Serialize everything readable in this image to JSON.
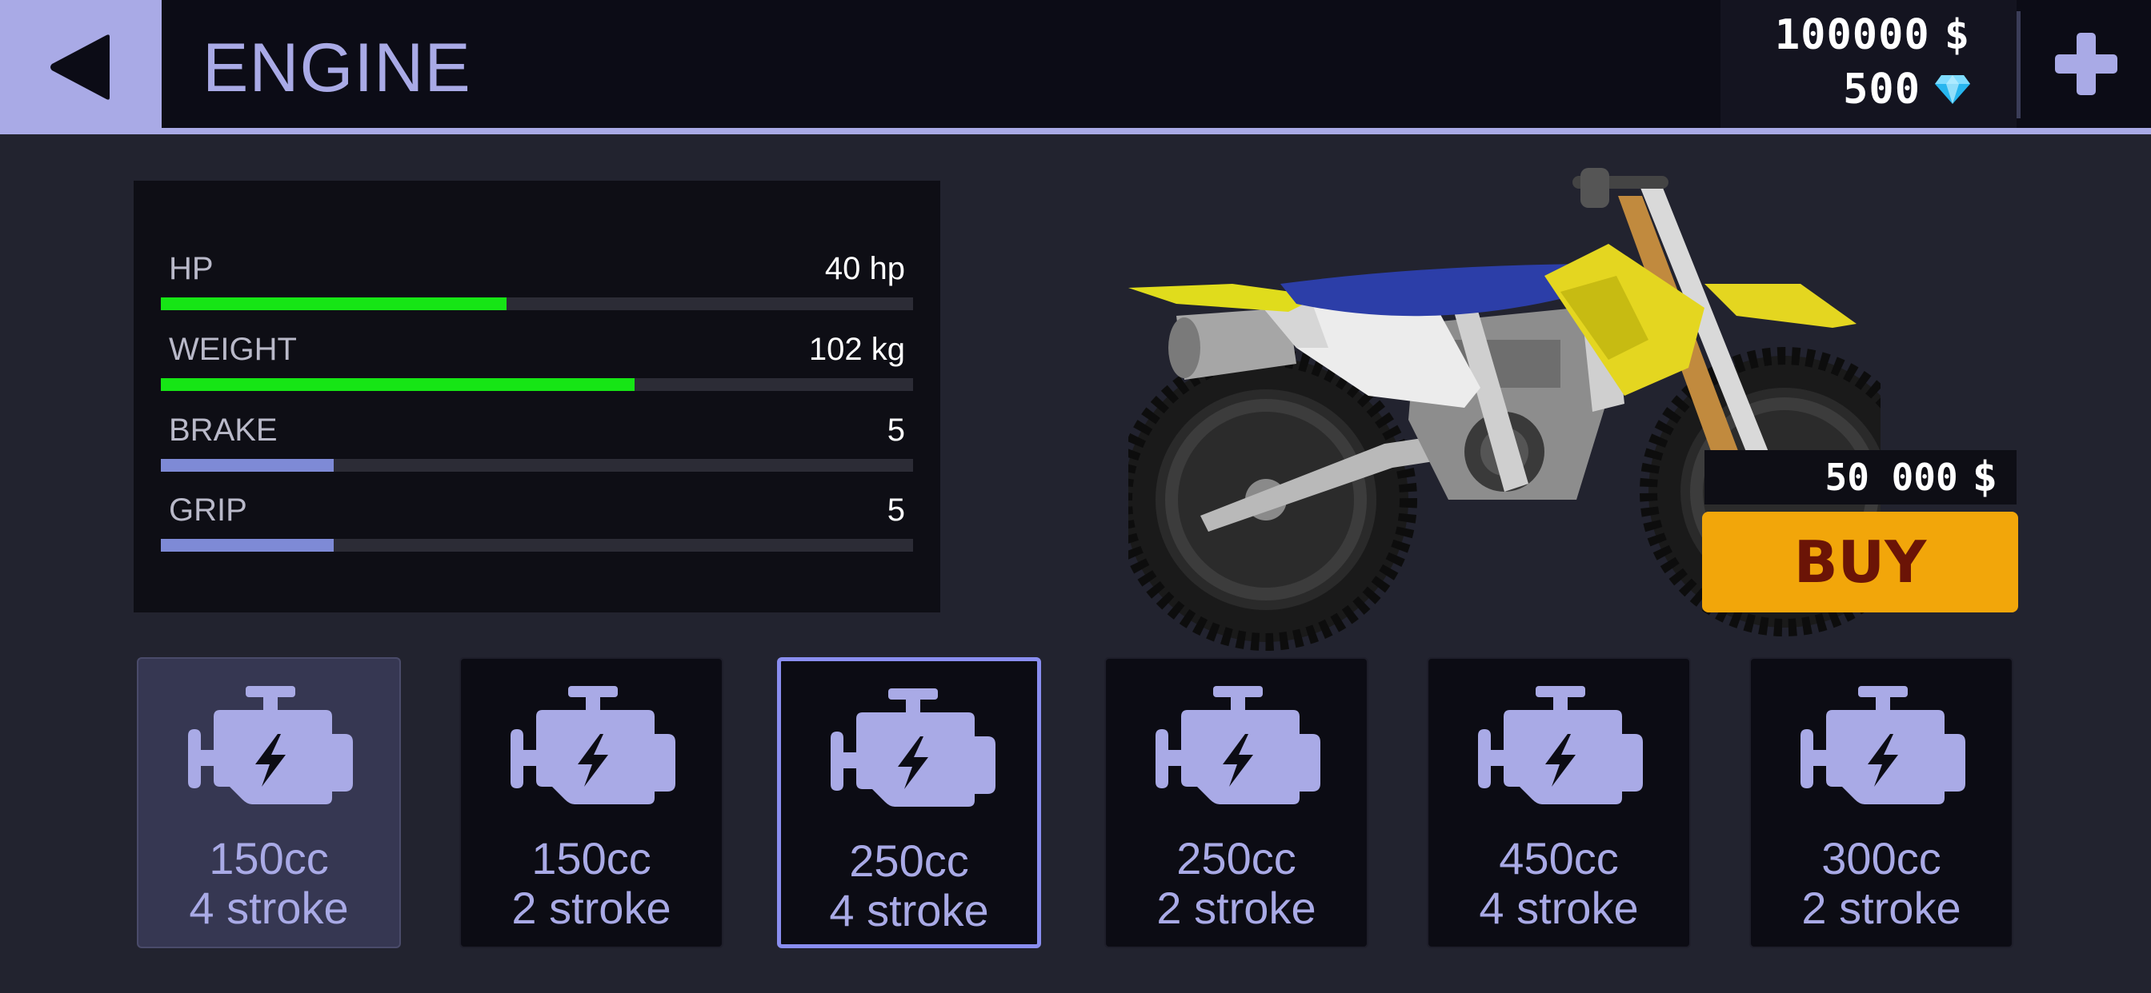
{
  "header": {
    "title": "ENGINE",
    "cash": "100000",
    "cash_symbol": "$",
    "gems": "500"
  },
  "stats": [
    {
      "label": "HP",
      "value": "40 hp",
      "fill": 0.46,
      "color": "#16e515"
    },
    {
      "label": "WEIGHT",
      "value": "102 kg",
      "fill": 0.63,
      "color": "#16e515"
    },
    {
      "label": "BRAKE",
      "value": "5",
      "fill": 0.23,
      "color": "#7e8ad6"
    },
    {
      "label": "GRIP",
      "value": "5",
      "fill": 0.23,
      "color": "#7e8ad6"
    }
  ],
  "purchase": {
    "price": "50 000",
    "price_symbol": "$",
    "buy_label": "BUY"
  },
  "engines": [
    {
      "size": "150cc",
      "type": "4 stroke",
      "state": "owned"
    },
    {
      "size": "150cc",
      "type": "2 stroke",
      "state": "normal"
    },
    {
      "size": "250cc",
      "type": "4 stroke",
      "state": "selected"
    },
    {
      "size": "250cc",
      "type": "2 stroke",
      "state": "normal"
    },
    {
      "size": "450cc",
      "type": "4 stroke",
      "state": "normal"
    },
    {
      "size": "300cc",
      "type": "2 stroke",
      "state": "normal"
    }
  ],
  "icons": {
    "back": "back-arrow-icon",
    "add": "plus-icon",
    "gem": "diamond-icon",
    "engine": "engine-icon"
  },
  "colors": {
    "accent": "#a9aae6",
    "buy": "#f2a60a",
    "stat_good": "#16e515",
    "stat_base": "#7e8ad6",
    "selected_border": "#8a8ef0"
  }
}
